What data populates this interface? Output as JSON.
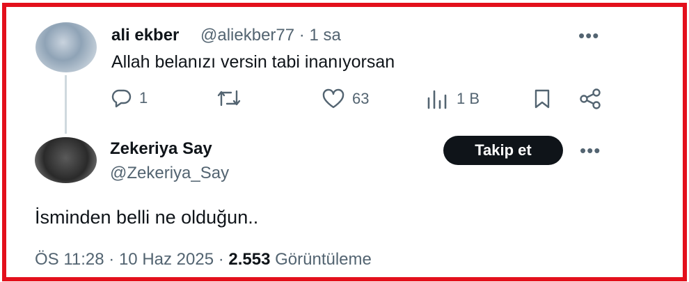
{
  "tweet1": {
    "name": "ali ekber",
    "handle": "@aliekber77",
    "time": "1 sa",
    "text": "Allah belanızı versin tabi inanıyorsan",
    "replies": "1",
    "likes": "63",
    "views": "1 B"
  },
  "tweet2": {
    "name": "Zekeriya Say",
    "handle": "@Zekeriya_Say",
    "follow_label": "Takip et",
    "text": "İsminden belli ne olduğun..",
    "time": "ÖS 11:28",
    "date": "10 Haz 2025",
    "views_count": "2.553",
    "views_label": "Görüntüleme"
  },
  "icons": [
    "reply-icon",
    "retweet-icon",
    "like-icon",
    "views-icon",
    "bookmark-icon",
    "share-icon",
    "more-icon"
  ],
  "colors": {
    "border": "#e3101c",
    "follow_bg": "#0f1419",
    "muted": "#536471"
  }
}
